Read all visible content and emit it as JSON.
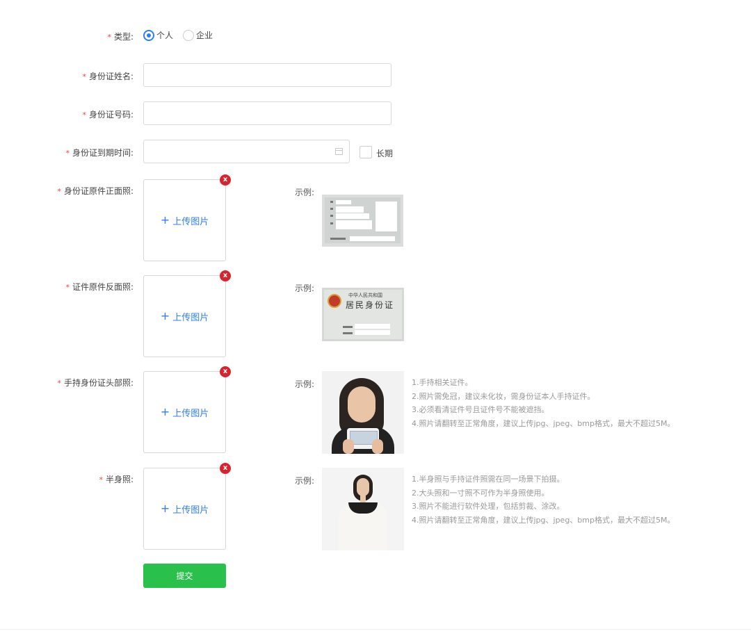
{
  "form": {
    "type": {
      "label": "类型:",
      "options": [
        "个人",
        "企业"
      ],
      "selected": 0
    },
    "name_label": "身份证姓名:",
    "name_value": "",
    "id_number_label": "身份证号码:",
    "id_number_value": "",
    "expiry_label": "身份证到期时间:",
    "expiry_value": "",
    "long_term_label": "长期",
    "front_label": "身份证原件正面照:",
    "back_label": "证件原件反面照:",
    "hold_label": "手持身份证头部照:",
    "half_label": "半身照:",
    "upload_text": "上传图片",
    "upload_plus": "+",
    "example_label": "示例:",
    "delete_glyph": "x",
    "emblem_text_1": "中华人民共和国",
    "emblem_text_2": "居民身份证",
    "submit_label": "提交"
  },
  "hold_notes": [
    "1.手持相关证件。",
    "2.照片需免冠，建议未化妆，需身份证本人手持证件。",
    "3.必须看清证件号且证件号不能被遮挡。",
    "4.照片请翻转至正常角度，建议上传jpg、jpeg、bmp格式，最大不超过5M。"
  ],
  "half_notes": [
    "1.半身照与手持证件照需在同一场景下拍摄。",
    "2.大头照和一寸照不可作为半身照使用。",
    "3.照片不能进行软件处理，包括剪裁、涂改。",
    "4.照片请翻转至正常角度，建议上传jpg、jpeg、bmp格式，最大不超过5M。"
  ],
  "colors": {
    "accent": "#2f7ef0",
    "required": "#e8453c",
    "submit": "#2ac04c",
    "delete": "#d9232d"
  }
}
